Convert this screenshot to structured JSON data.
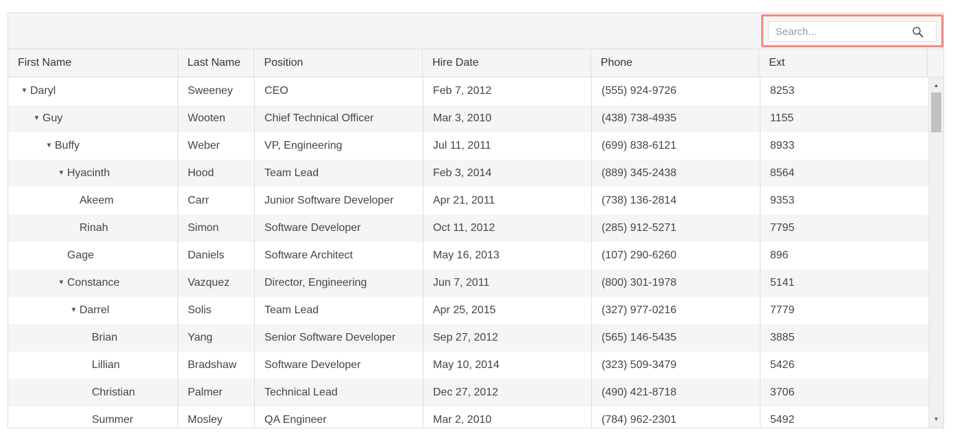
{
  "search": {
    "placeholder": "Search..."
  },
  "columns": [
    "First Name",
    "Last Name",
    "Position",
    "Hire Date",
    "Phone",
    "Ext"
  ],
  "rows": [
    {
      "level": 0,
      "expanded": true,
      "first": "Daryl",
      "last": "Sweeney",
      "position": "CEO",
      "hire": "Feb 7, 2012",
      "phone": "(555) 924-9726",
      "ext": "8253"
    },
    {
      "level": 1,
      "expanded": true,
      "first": "Guy",
      "last": "Wooten",
      "position": "Chief Technical Officer",
      "hire": "Mar 3, 2010",
      "phone": "(438) 738-4935",
      "ext": "1155"
    },
    {
      "level": 2,
      "expanded": true,
      "first": "Buffy",
      "last": "Weber",
      "position": "VP, Engineering",
      "hire": "Jul 11, 2011",
      "phone": "(699) 838-6121",
      "ext": "8933"
    },
    {
      "level": 3,
      "expanded": true,
      "first": "Hyacinth",
      "last": "Hood",
      "position": "Team Lead",
      "hire": "Feb 3, 2014",
      "phone": "(889) 345-2438",
      "ext": "8564"
    },
    {
      "level": 4,
      "expanded": null,
      "first": "Akeem",
      "last": "Carr",
      "position": "Junior Software Developer",
      "hire": "Apr 21, 2011",
      "phone": "(738) 136-2814",
      "ext": "9353"
    },
    {
      "level": 4,
      "expanded": null,
      "first": "Rinah",
      "last": "Simon",
      "position": "Software Developer",
      "hire": "Oct 11, 2012",
      "phone": "(285) 912-5271",
      "ext": "7795"
    },
    {
      "level": 3,
      "expanded": null,
      "first": "Gage",
      "last": "Daniels",
      "position": "Software Architect",
      "hire": "May 16, 2013",
      "phone": "(107) 290-6260",
      "ext": "896"
    },
    {
      "level": 3,
      "expanded": true,
      "first": "Constance",
      "last": "Vazquez",
      "position": "Director, Engineering",
      "hire": "Jun 7, 2011",
      "phone": "(800) 301-1978",
      "ext": "5141"
    },
    {
      "level": 4,
      "expanded": true,
      "first": "Darrel",
      "last": "Solis",
      "position": "Team Lead",
      "hire": "Apr 25, 2015",
      "phone": "(327) 977-0216",
      "ext": "7779"
    },
    {
      "level": 5,
      "expanded": null,
      "first": "Brian",
      "last": "Yang",
      "position": "Senior Software Developer",
      "hire": "Sep 27, 2012",
      "phone": "(565) 146-5435",
      "ext": "3885"
    },
    {
      "level": 5,
      "expanded": null,
      "first": "Lillian",
      "last": "Bradshaw",
      "position": "Software Developer",
      "hire": "May 10, 2014",
      "phone": "(323) 509-3479",
      "ext": "5426"
    },
    {
      "level": 5,
      "expanded": null,
      "first": "Christian",
      "last": "Palmer",
      "position": "Technical Lead",
      "hire": "Dec 27, 2012",
      "phone": "(490) 421-8718",
      "ext": "3706"
    },
    {
      "level": 5,
      "expanded": null,
      "first": "Summer",
      "last": "Mosley",
      "position": "QA Engineer",
      "hire": "Mar 2, 2010",
      "phone": "(784) 962-2301",
      "ext": "5492"
    }
  ],
  "icons": {
    "search": "search-icon",
    "expand": "caret-down-icon",
    "scroll_up": "scroll-up-arrow-icon",
    "scroll_down": "scroll-down-arrow-icon"
  },
  "colors": {
    "highlight": "#f28b82",
    "header_bg": "#f5f5f5",
    "alt_row": "#f5f5f5",
    "border": "#dddddd"
  }
}
